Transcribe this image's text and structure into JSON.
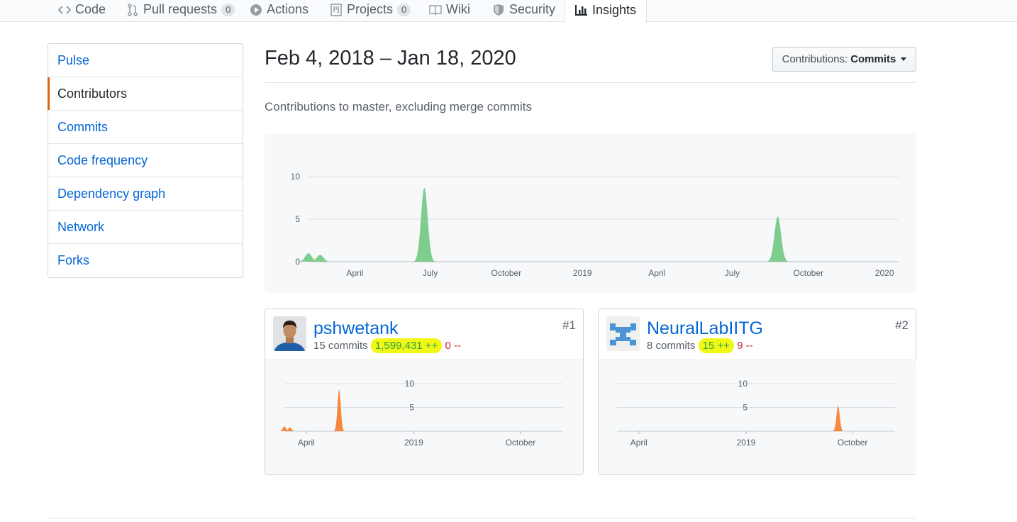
{
  "tabs": [
    {
      "label": "Code",
      "icon": "code-icon"
    },
    {
      "label": "Pull requests",
      "icon": "pull-request-icon",
      "count": "0"
    },
    {
      "label": "Actions",
      "icon": "play-icon"
    },
    {
      "label": "Projects",
      "icon": "project-icon",
      "count": "0"
    },
    {
      "label": "Wiki",
      "icon": "book-icon"
    },
    {
      "label": "Security",
      "icon": "shield-icon"
    },
    {
      "label": "Insights",
      "icon": "graph-icon",
      "selected": true
    }
  ],
  "sidebar": {
    "items": [
      {
        "label": "Pulse"
      },
      {
        "label": "Contributors",
        "selected": true
      },
      {
        "label": "Commits"
      },
      {
        "label": "Code frequency"
      },
      {
        "label": "Dependency graph"
      },
      {
        "label": "Network"
      },
      {
        "label": "Forks"
      }
    ]
  },
  "header": {
    "title": "Feb 4, 2018 – Jan 18, 2020",
    "contributions_prefix": "Contributions:",
    "contributions_value": "Commits",
    "subtitle": "Contributions to master, excluding merge commits"
  },
  "colors": {
    "link": "#0366d6",
    "main_area": "#7fcc8f",
    "contributor_area": "#f5883a",
    "highlight": "#f2f716",
    "selected_accent": "#e36209"
  },
  "chart_data": [
    {
      "type": "area",
      "title": "",
      "x_range": [
        "2018-02-04",
        "2020-01-18"
      ],
      "y_ticks": [
        "0",
        "5",
        "10"
      ],
      "x_ticks": [
        "April",
        "July",
        "October",
        "2019",
        "April",
        "July",
        "October",
        "2020"
      ],
      "ylim": [
        0,
        10
      ],
      "grid": true,
      "points": [
        {
          "x": "2018-02-04",
          "y": 1
        },
        {
          "x": "2018-02-18",
          "y": 0.8
        },
        {
          "x": "2018-06-24",
          "y": 8.7
        },
        {
          "x": "2019-08-25",
          "y": 5.3
        }
      ]
    },
    {
      "type": "area",
      "title": "",
      "series_owner": "pshwetank",
      "y_ticks": [
        "5",
        "10"
      ],
      "x_ticks": [
        "April",
        "2019",
        "October"
      ],
      "ylim": [
        0,
        10
      ],
      "points": [
        {
          "x": "2018-02-04",
          "y": 1
        },
        {
          "x": "2018-02-18",
          "y": 0.8
        },
        {
          "x": "2018-06-24",
          "y": 8.7
        }
      ]
    },
    {
      "type": "area",
      "title": "",
      "series_owner": "NeuralLabIITG",
      "y_ticks": [
        "5",
        "10"
      ],
      "x_ticks": [
        "April",
        "2019",
        "October"
      ],
      "ylim": [
        0,
        10
      ],
      "points": [
        {
          "x": "2019-08-25",
          "y": 5.3
        }
      ]
    }
  ],
  "contributors": [
    {
      "username": "pshwetank",
      "commits": "15 commits",
      "additions": "1,599,431 ++",
      "deletions": "0 --",
      "rank": "#1",
      "avatar_icon": "user-photo-avatar"
    },
    {
      "username": "NeuralLabIITG",
      "commits": "8 commits",
      "additions": "15 ++",
      "deletions": "9 --",
      "rank": "#2",
      "avatar_icon": "identicon-avatar"
    }
  ]
}
